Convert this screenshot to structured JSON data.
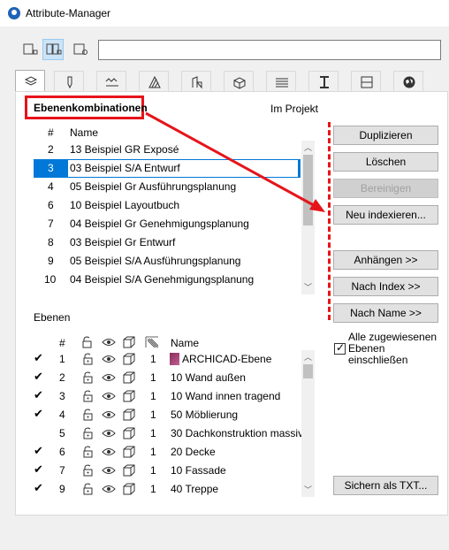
{
  "window": {
    "title": "Attribute-Manager"
  },
  "search": {
    "value": ""
  },
  "tabs": [
    {
      "icon": "layers-icon"
    },
    {
      "icon": "pen-icon"
    },
    {
      "icon": "line-type-icon"
    },
    {
      "icon": "fill-icon"
    },
    {
      "icon": "composite-icon"
    },
    {
      "icon": "building-material-icon"
    },
    {
      "icon": "surface-icon"
    },
    {
      "icon": "profile-icon"
    },
    {
      "icon": "zone-icon"
    },
    {
      "icon": "mep-icon"
    },
    {
      "icon": "globe-icon"
    }
  ],
  "combinations": {
    "header": "Ebenenkombinationen",
    "scope": "Im Projekt",
    "col_num": "#",
    "col_name": "Name",
    "rows": [
      {
        "num": "2",
        "name": "13 Beispiel GR Exposé"
      },
      {
        "num": "3",
        "name": "03 Beispiel S/A Entwurf"
      },
      {
        "num": "4",
        "name": "05 Beispiel Gr Ausführungsplanung"
      },
      {
        "num": "6",
        "name": "10 Beispiel Layoutbuch"
      },
      {
        "num": "7",
        "name": "04 Beispiel Gr Genehmigungsplanung"
      },
      {
        "num": "8",
        "name": "03 Beispiel Gr Entwurf"
      },
      {
        "num": "9",
        "name": "05 Beispiel S/A Ausführungsplanung"
      },
      {
        "num": "10",
        "name": "04 Beispiel S/A Genehmigungsplanung"
      }
    ]
  },
  "buttons": {
    "duplicate": "Duplizieren",
    "delete": "Löschen",
    "purge": "Bereinigen",
    "reindex": "Neu indexieren...",
    "append": "Anhängen >>",
    "by_index": "Nach Index >>",
    "by_name": "Nach Name >>",
    "save_txt": "Sichern als TXT..."
  },
  "layers": {
    "header": "Ebenen",
    "col_num": "#",
    "col_name": "Name",
    "rows": [
      {
        "checked": true,
        "num": "1",
        "pen": "1",
        "name": "ARCHICAD-Ebene"
      },
      {
        "checked": true,
        "num": "2",
        "pen": "1",
        "name": "10 Wand außen"
      },
      {
        "checked": true,
        "num": "3",
        "pen": "1",
        "name": "10 Wand innen tragend"
      },
      {
        "checked": true,
        "num": "4",
        "pen": "1",
        "name": "50 Möblierung"
      },
      {
        "checked": false,
        "num": "5",
        "pen": "1",
        "name": "30 Dachkonstruktion massiv"
      },
      {
        "checked": true,
        "num": "6",
        "pen": "1",
        "name": "20 Decke"
      },
      {
        "checked": true,
        "num": "7",
        "pen": "1",
        "name": "10 Fassade"
      },
      {
        "checked": true,
        "num": "9",
        "pen": "1",
        "name": "40 Treppe"
      }
    ]
  },
  "include_checkbox": {
    "label": "Alle zugewiesenen Ebenen einschließen",
    "checked": true
  },
  "colors": {
    "accent": "#0078d7",
    "annotation": "#e6141a"
  }
}
